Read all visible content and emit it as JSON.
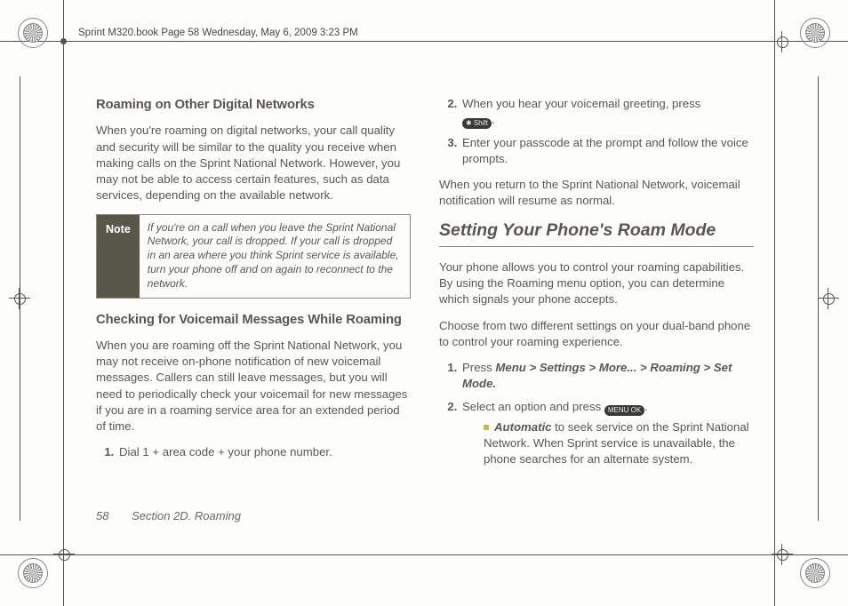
{
  "book_header": "Sprint M320.book  Page 58  Wednesday, May 6, 2009  3:23 PM",
  "left": {
    "h1": "Roaming on Other Digital Networks",
    "p1": "When you're roaming on digital networks, your call quality and security will be similar to the quality you receive when making calls on the Sprint National Network. However, you may not be able to access certain features, such as data services, depending on the available network.",
    "note_label": "Note",
    "note_text": "If you're on a call when you leave the Sprint National Network, your call is dropped. If your call is dropped in an area where you think Sprint service is available, turn your phone off and on again to reconnect to the network.",
    "h2": "Checking for Voicemail Messages While Roaming",
    "p2": "When you are roaming off the Sprint National Network, you may not receive on-phone notification of new voicemail messages. Callers can still leave messages, but you will need to periodically check your voicemail for new messages if you are in a roaming service area for an extended period of time.",
    "step1": "Dial 1 + area code + your phone number."
  },
  "right": {
    "step2": "When you hear your voicemail greeting, press ",
    "key2": "✱ Shift",
    "step3": "Enter your passcode at the prompt and follow the voice prompts.",
    "p_after": "When you return to the Sprint National Network, voicemail notification will resume as normal.",
    "section": "Setting Your Phone's Roam Mode",
    "p1": "Your phone allows you to control your roaming capabilities. By using the Roaming menu option, you can determine which signals your phone accepts.",
    "p2": "Choose from two different settings on your dual-band phone to control your roaming experience.",
    "s1_a": "Press ",
    "s1_path": "Menu > Settings > More... > Roaming > Set Mode.",
    "s2_a": "Select an option and press ",
    "s2_key": "MENU OK",
    "s2_b": ".",
    "bullet_em": "Automatic",
    "bullet_rest": " to seek service on the Sprint National Network. When Sprint service is unavailable, the phone searches for an alternate system."
  },
  "footer": {
    "page": "58",
    "section": "Section 2D. Roaming"
  }
}
